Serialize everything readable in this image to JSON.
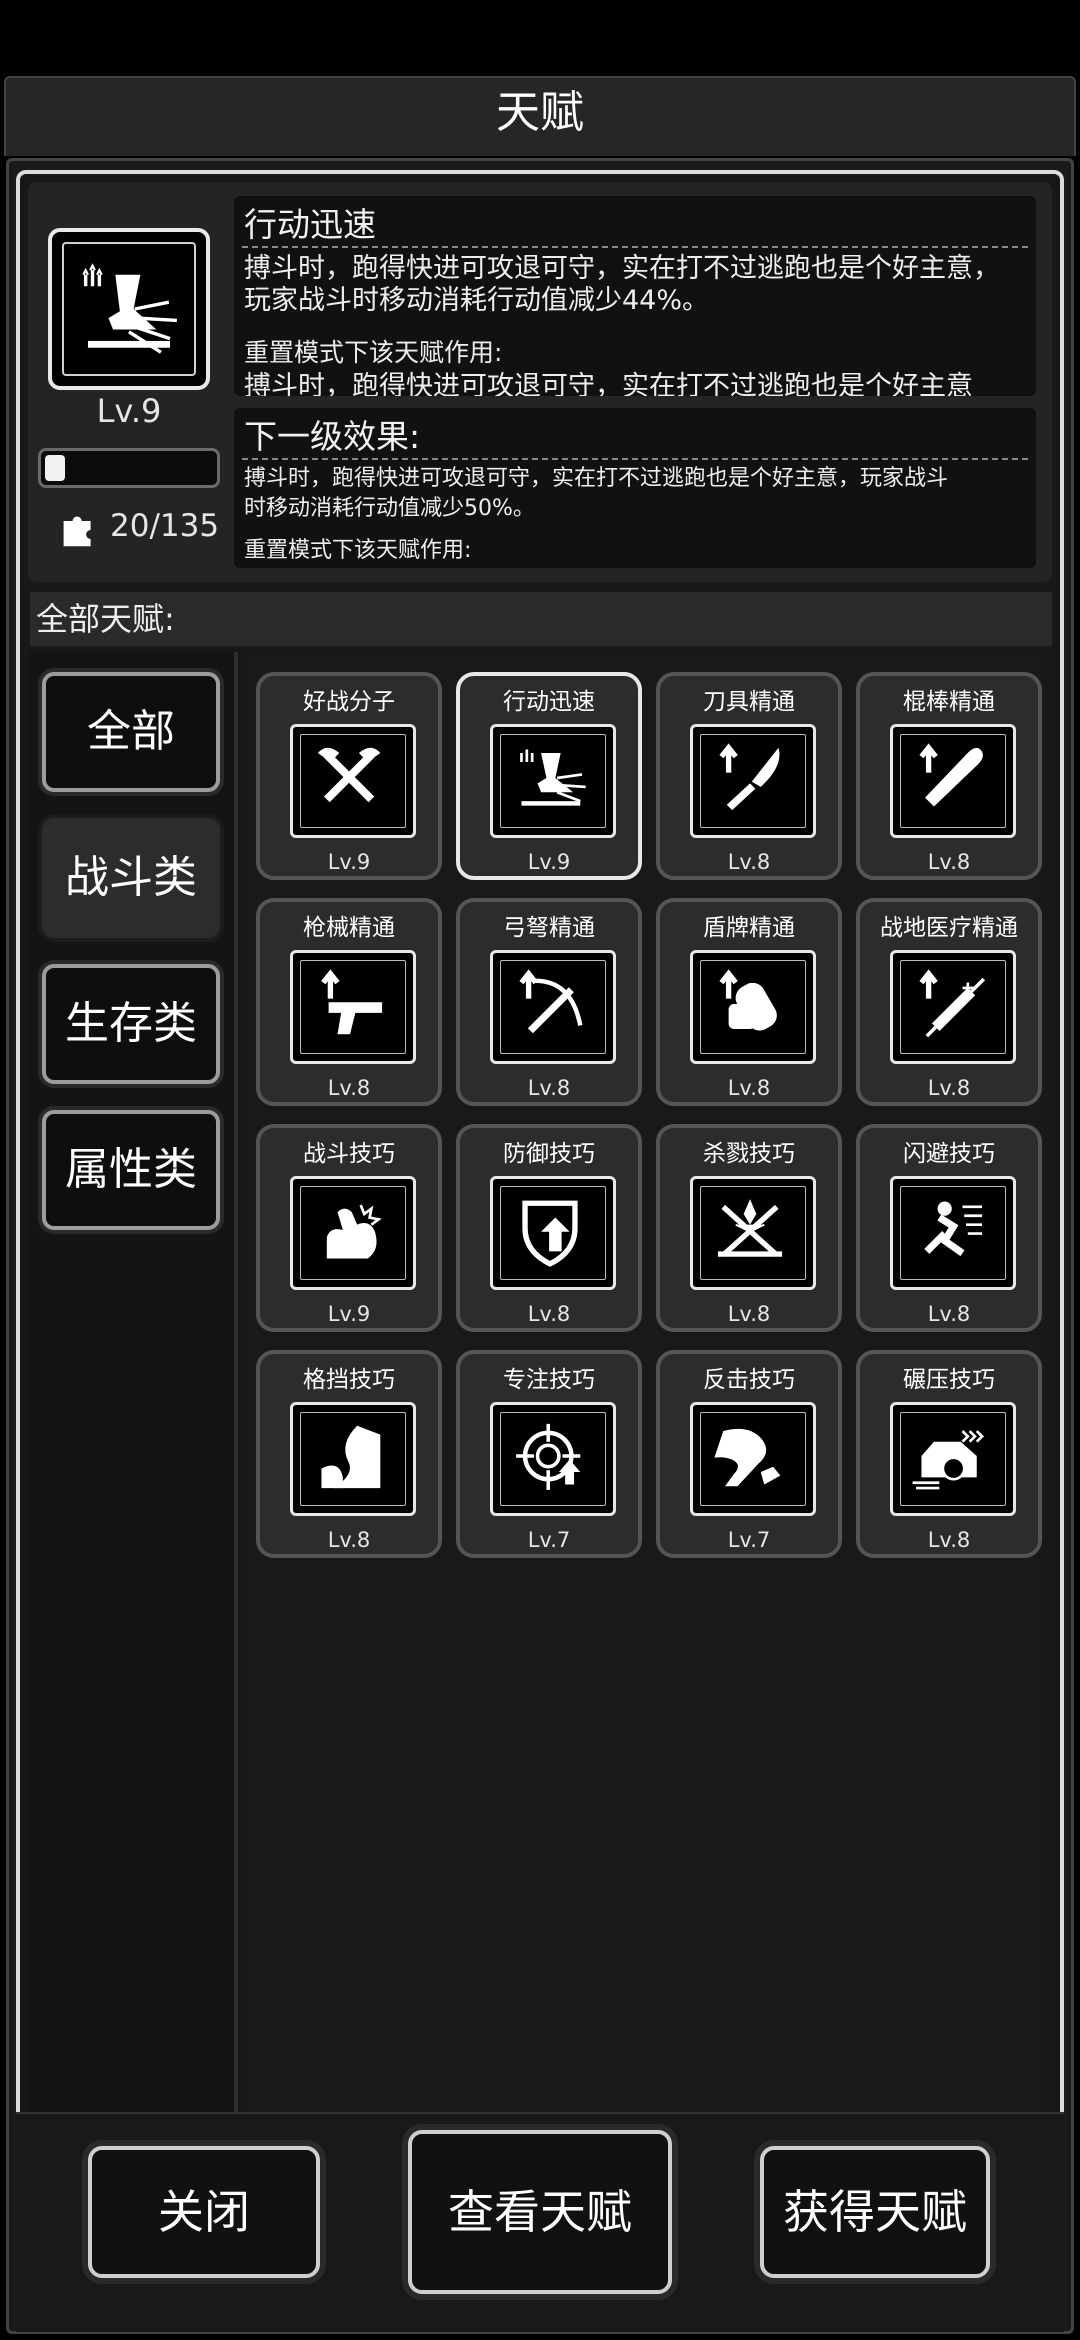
{
  "window": {
    "title": "天赋"
  },
  "selected": {
    "name": "行动迅速",
    "level": "Lv.9",
    "progress": 0.07,
    "pieces": "20/135",
    "description_lines": [
      "搏斗时，跑得快进可攻退可守，实在打不过逃跑也是个好主意，",
      "玩家战斗时移动消耗行动值减少44%。",
      "",
      "重置模式下该天赋作用:",
      "搏斗时，跑得快进可攻退可守，实在打不过逃跑也是个好主意"
    ],
    "next_title": "下一级效果:",
    "next_lines": [
      "搏斗时，跑得快进可攻退可守，实在打不过逃跑也是个好主意，玩家战斗",
      "时移动消耗行动值减少50%。",
      "",
      "重置模式下该天赋作用:"
    ]
  },
  "section_label": "全部天赋:",
  "tabs": [
    {
      "label": "全部",
      "active": false
    },
    {
      "label": "战斗类",
      "active": true
    },
    {
      "label": "生存类",
      "active": false
    },
    {
      "label": "属性类",
      "active": false
    }
  ],
  "talents": [
    {
      "name": "好战分子",
      "level": "Lv.9",
      "icon": "crossed-axes-icon"
    },
    {
      "name": "行动迅速",
      "level": "Lv.9",
      "icon": "running-foot-icon",
      "selected": true
    },
    {
      "name": "刀具精通",
      "level": "Lv.8",
      "icon": "knife-upgrade-icon"
    },
    {
      "name": "棍棒精通",
      "level": "Lv.8",
      "icon": "club-upgrade-icon"
    },
    {
      "name": "枪械精通",
      "level": "Lv.8",
      "icon": "pistol-upgrade-icon"
    },
    {
      "name": "弓弩精通",
      "level": "Lv.8",
      "icon": "crossbow-upgrade-icon"
    },
    {
      "name": "盾牌精通",
      "level": "Lv.8",
      "icon": "shield-upgrade-icon"
    },
    {
      "name": "战地医疗精通",
      "level": "Lv.8",
      "icon": "syringe-upgrade-icon"
    },
    {
      "name": "战斗技巧",
      "level": "Lv.9",
      "icon": "flexed-arm-icon"
    },
    {
      "name": "防御技巧",
      "level": "Lv.8",
      "icon": "defense-up-icon"
    },
    {
      "name": "杀戮技巧",
      "level": "Lv.8",
      "icon": "crossed-swords-icon"
    },
    {
      "name": "闪避技巧",
      "level": "Lv.8",
      "icon": "dodge-icon"
    },
    {
      "name": "格挡技巧",
      "level": "Lv.8",
      "icon": "block-icon"
    },
    {
      "name": "专注技巧",
      "level": "Lv.7",
      "icon": "crosshair-up-icon"
    },
    {
      "name": "反击技巧",
      "level": "Lv.7",
      "icon": "counter-arm-icon"
    },
    {
      "name": "碾压技巧",
      "level": "Lv.8",
      "icon": "car-crush-icon"
    }
  ],
  "buttons": {
    "close": "关闭",
    "view": "查看天赋",
    "obtain": "获得天赋"
  }
}
